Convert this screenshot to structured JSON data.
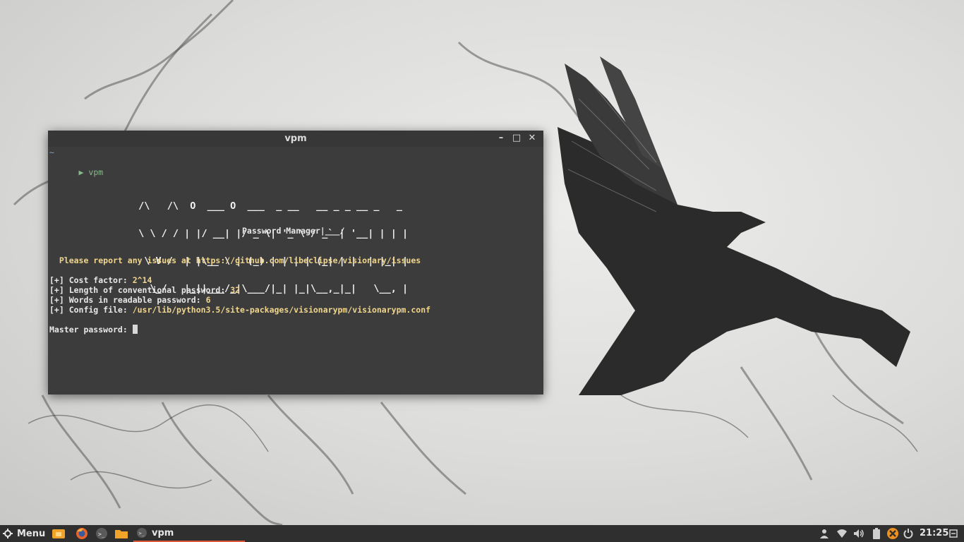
{
  "window": {
    "title": "vpm",
    "controls": {
      "minimize": "–",
      "maximize": "□",
      "close": "✕"
    }
  },
  "terminal": {
    "cwd": "~",
    "prompt_symbol": "▶",
    "command": "vpm",
    "banner_lines": [
      " /\\   /\\  O  ___ O  ___  _ __   __ _ _ __ _   _ ",
      " \\ \\ / / | |/ __| |/ _ \\| '_ \\ / _` | '__| | | |",
      "  \\ V /  | |\\__ \\ | (_) | | | | (_| | |  | |_| |",
      "   \\_/   |_||___/_|\\___/|_| |_|\\__,_|_|   \\__, |"
    ],
    "banner_subtitle": "Password Manager|___/",
    "report_line": "  Please report any issues at https://github.com/libeclipse/visionary/issues",
    "info": [
      {
        "label": "[+] Cost factor: ",
        "value": "2^14"
      },
      {
        "label": "[+] Length of conventional password: ",
        "value": "32"
      },
      {
        "label": "[+] Words in readable password: ",
        "value": "6"
      },
      {
        "label": "[+] Config file: ",
        "value": "/usr/lib/python3.5/site-packages/visionarypm/visionarypm.conf"
      }
    ],
    "input_prompt": "Master password: "
  },
  "taskbar": {
    "menu_label": "Menu",
    "launchers": [
      "home-folder-icon",
      "firefox-icon",
      "terminal-icon",
      "files-icon"
    ],
    "active_task_label": "vpm",
    "tray_icons": [
      "user-icon",
      "wifi-icon",
      "volume-icon",
      "battery-icon",
      "update-icon",
      "power-icon",
      "clock-icon"
    ],
    "clock": "21:25"
  },
  "colors": {
    "terminal_bg": "#3c3c3c",
    "highlight_yellow": "#f0d58c",
    "taskbar_bg": "#2f2f2f",
    "active_task_underline": "#e0583c"
  }
}
